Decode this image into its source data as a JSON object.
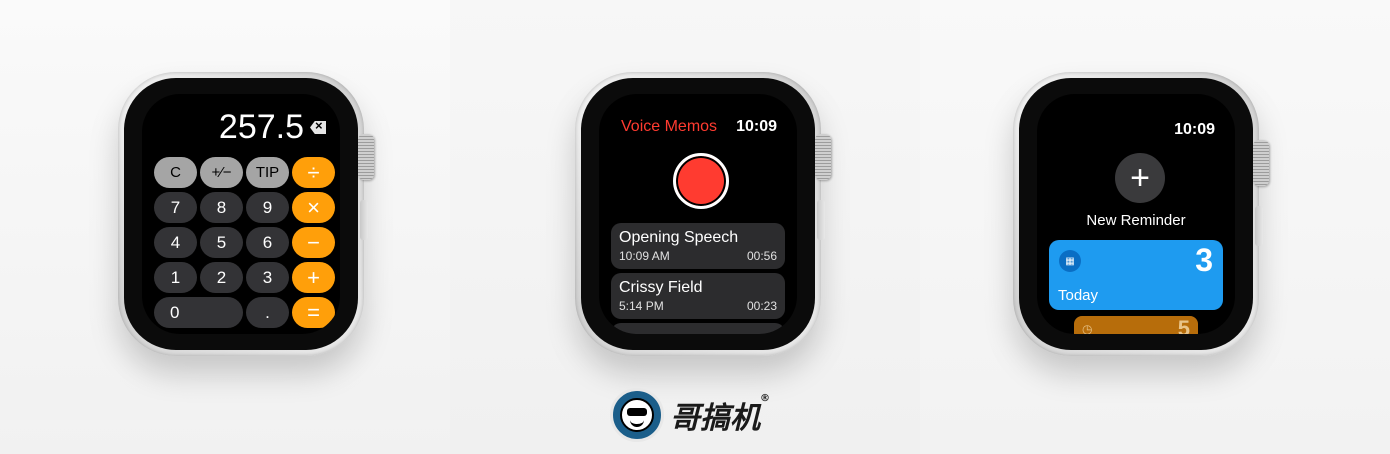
{
  "calculator": {
    "display": "257.5",
    "keys": [
      "C",
      "+⁄−",
      "TIP",
      "÷",
      "7",
      "8",
      "9",
      "×",
      "4",
      "5",
      "6",
      "−",
      "1",
      "2",
      "3",
      "+",
      "0",
      ".",
      "="
    ]
  },
  "voice_memos": {
    "title": "Voice Memos",
    "time": "10:09",
    "recordings": [
      {
        "name": "Opening Speech",
        "time": "10:09 AM",
        "duration": "00:56"
      },
      {
        "name": "Crissy Field",
        "time": "5:14 PM",
        "duration": "00:23"
      }
    ]
  },
  "reminders": {
    "time": "10:09",
    "new_label": "New Reminder",
    "cards": [
      {
        "label": "Today",
        "count": "3",
        "color": "#1e9bf0",
        "icon": "calendar-icon"
      },
      {
        "label": "",
        "count": "5",
        "color": "#b76d0b",
        "icon": "clock-icon"
      }
    ]
  },
  "logo": {
    "text": "哥搞机",
    "mark": "®"
  }
}
